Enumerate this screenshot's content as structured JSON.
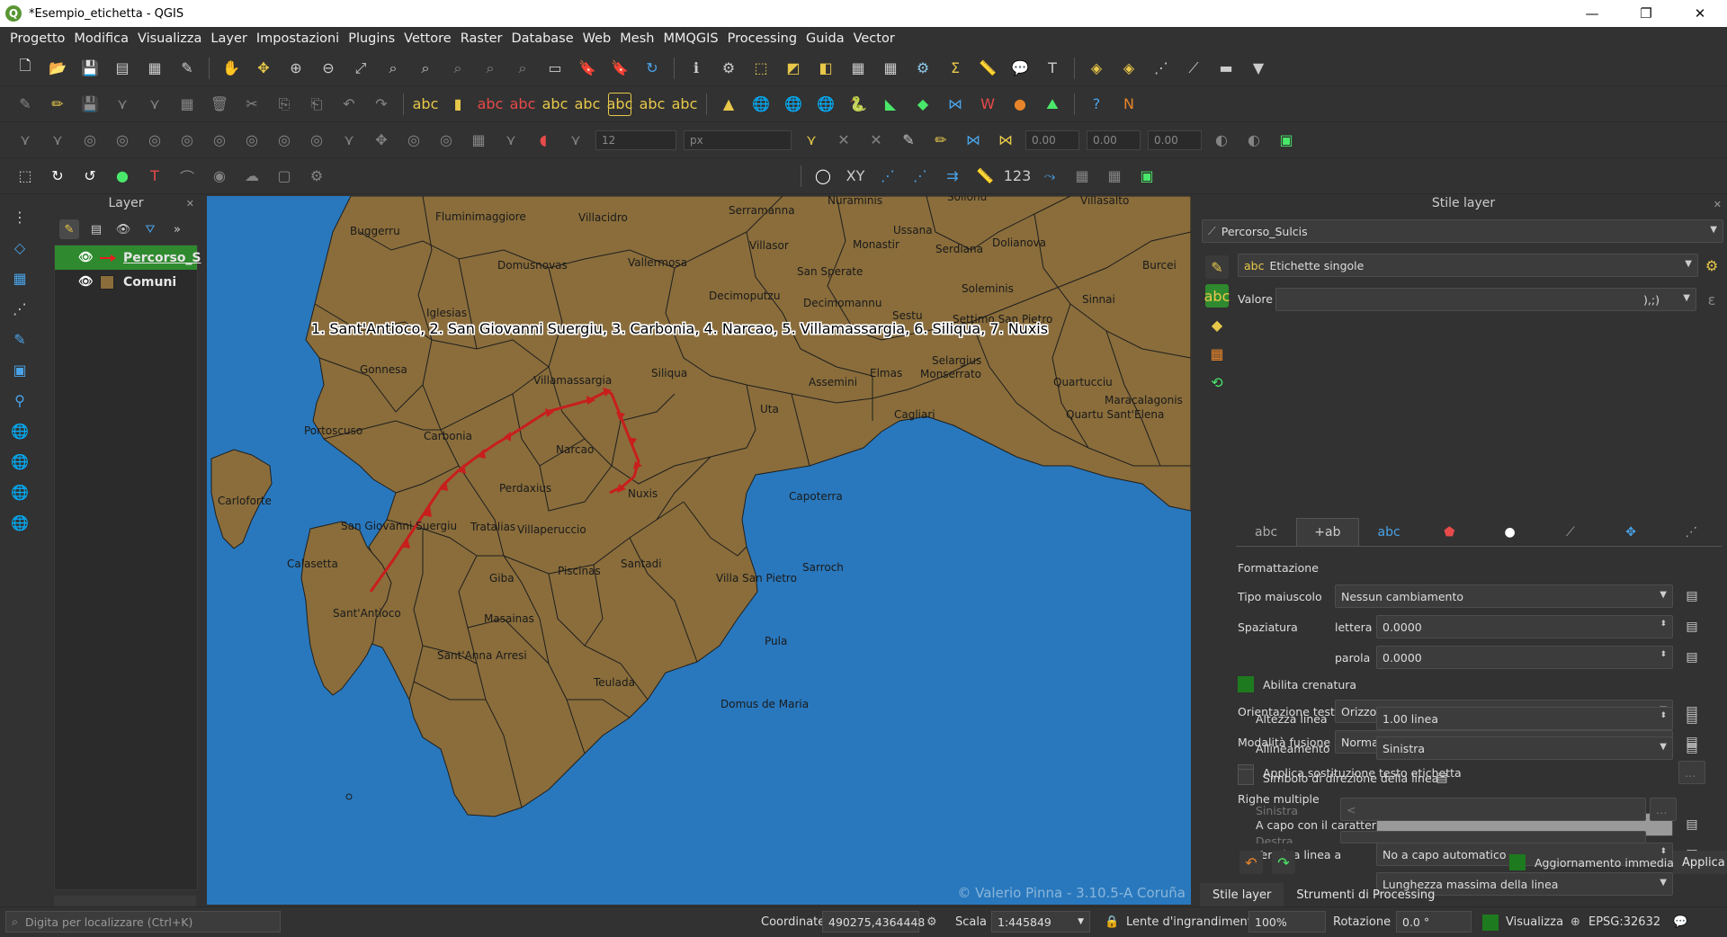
{
  "window": {
    "title": "*Esempio_etichetta - QGIS",
    "minimize": "—",
    "maximize": "❐",
    "close": "✕"
  },
  "menu": [
    "Progetto",
    "Modifica",
    "Visualizza",
    "Layer",
    "Impostazioni",
    "Plugins",
    "Vettore",
    "Raster",
    "Database",
    "Web",
    "Mesh",
    "MMQGIS",
    "Processing",
    "Guida",
    "Vector"
  ],
  "toolbar3": {
    "size_value": "12",
    "unit": "px",
    "v1": "0.00",
    "v2": "0.00",
    "v3": "0.00"
  },
  "layers_panel": {
    "title": "Layer",
    "layers": [
      {
        "name": "Percorso_S",
        "selected": true,
        "symbol": "red-arrow",
        "visible": true
      },
      {
        "name": "Comuni",
        "selected": false,
        "symbol": "#8a6d3b",
        "visible": true
      }
    ]
  },
  "map": {
    "route_label": "1. Sant'Antioco, 2. San Giovanni Suergiu, 3. Carbonia, 4. Narcao, 5. Villamassargia, 6. Siliqua, 7. Nuxis",
    "copyright": "© Valerio Pinna - 3.10.5-A Coruña",
    "towns": [
      "Buggerru",
      "Fluminimaggiore",
      "Villacidro",
      "Serramanna",
      "Nuraminis",
      "Ussana",
      "Dolianova",
      "Sollohu",
      "Villasalto",
      "Domusnovas",
      "Vallermosa",
      "Villasor",
      "Monastir",
      "Serdiana",
      "Burcei",
      "San Sperate",
      "Decimoputzu",
      "Decimomannu",
      "Soleminis",
      "Sinnai",
      "Iglesias",
      "Sestu",
      "Settimo San Pietro",
      "Gonnesa",
      "Villamassargia",
      "Siliqua",
      "Assemini",
      "Elmas",
      "Selargius",
      "Monserrato",
      "Quartucciu",
      "Maracalagonis",
      "Quartu Sant'Elena",
      "Cagliari",
      "Portoscuso",
      "Uta",
      "Carbonia",
      "Narcao",
      "Perdaxius",
      "Nuxis",
      "Capoterra",
      "Carloforte",
      "Tratalias",
      "Villaperuccio",
      "San Giovanni Suergiu",
      "Calasetta",
      "Giba",
      "Piscinas",
      "Santadi",
      "Villa San Pietro",
      "Sarroch",
      "Sant'Antioco",
      "Masainas",
      "Sant'Anna Arresi",
      "Pula",
      "Teulada",
      "Domus de Maria"
    ]
  },
  "style_panel": {
    "title": "Stile layer",
    "layer": "Percorso_Sulcis",
    "mode": "Etichette singole",
    "valore_label": "Valore",
    "valore": "),;)",
    "section": "Formattazione",
    "tipo_maiuscolo_label": "Tipo maiuscolo",
    "tipo_maiuscolo": "Nessun cambiamento",
    "spaziatura_label": "Spaziatura",
    "lettera_label": "lettera",
    "lettera": "0.0000",
    "parola_label": "parola",
    "parola": "0.0000",
    "crenatura": "Abilita crenatura",
    "orientazione_label": "Orientazione testo",
    "orientazione": "Orizzontale",
    "fusione_label": "Modalità fusione",
    "fusione": "Normale",
    "sostituzione": "Applica sostituzione testo etichetta",
    "righe_multiple": "Righe multiple",
    "a_capo_label": "A capo con il carattere",
    "termina_label": "Termina linea a",
    "termina": "No a capo automatico",
    "lunghezza": "Lunghezza massima della linea",
    "altezza_label": "Altezza linea",
    "altezza": "1.00 linea",
    "allineamento_label": "Allineamento",
    "allineamento": "Sinistra",
    "simbolo_direzione": "Simbolo di direzione della linea",
    "sinistra_label": "Sinistra",
    "sinistra": "<",
    "destra_label": "Destra",
    "aggiornamento": "Aggiornamento immediato",
    "applica": "Applica",
    "tabs_bottom": [
      "Stile layer",
      "Strumenti di Processing"
    ]
  },
  "statusbar": {
    "search_placeholder": "Digita per localizzare (Ctrl+K)",
    "coord_label": "Coordinate",
    "coord": "490275,4364448",
    "scala_label": "Scala",
    "scala": "1:445849",
    "lente_label": "Lente d'ingrandimento",
    "lente": "100%",
    "rotazione_label": "Rotazione",
    "rotazione": "0.0 °",
    "visualizza": "Visualizza",
    "epsg": "EPSG:32632"
  },
  "colors": {
    "sea": "#2978bd",
    "land": "#8a6d3b",
    "route": "#c81e1e",
    "accent": "#2f8a2f"
  }
}
